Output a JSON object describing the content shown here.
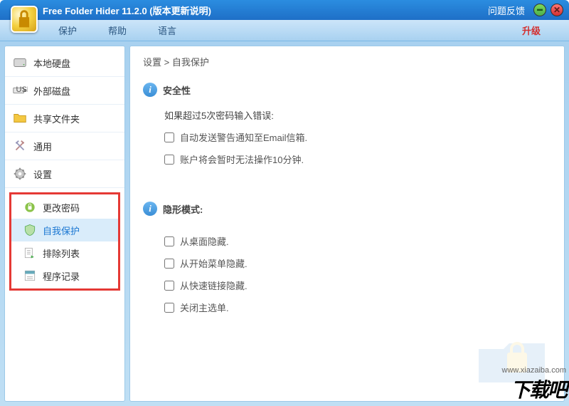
{
  "titlebar": {
    "title": "Free Folder Hider 11.2.0 (版本更新说明)",
    "feedback": "问题反馈"
  },
  "menu": {
    "protect": "保护",
    "help": "帮助",
    "language": "语言",
    "upgrade": "升级"
  },
  "sidebar": {
    "items": [
      {
        "label": "本地硬盘"
      },
      {
        "label": "外部磁盘"
      },
      {
        "label": "共享文件夹"
      },
      {
        "label": "通用"
      },
      {
        "label": "设置"
      }
    ],
    "subitems": [
      {
        "label": "更改密码"
      },
      {
        "label": "自我保护"
      },
      {
        "label": "排除列表"
      },
      {
        "label": "程序记录"
      }
    ]
  },
  "content": {
    "breadcrumb": "设置 > 自我保护",
    "section1": {
      "title": "安全性",
      "desc": "如果超过5次密码输入错误:",
      "check1": "自动发送警告通知至Email信箱.",
      "check2": "账户将会暂时无法操作10分钟."
    },
    "section2": {
      "title": "隐形模式:",
      "check1": "从桌面隐藏.",
      "check2": "从开始菜单隐藏.",
      "check3": "从快速链接隐藏.",
      "check4": "关闭主选单."
    }
  },
  "watermark": {
    "url": "www.xiazaiba.com",
    "logo": "下载吧"
  }
}
